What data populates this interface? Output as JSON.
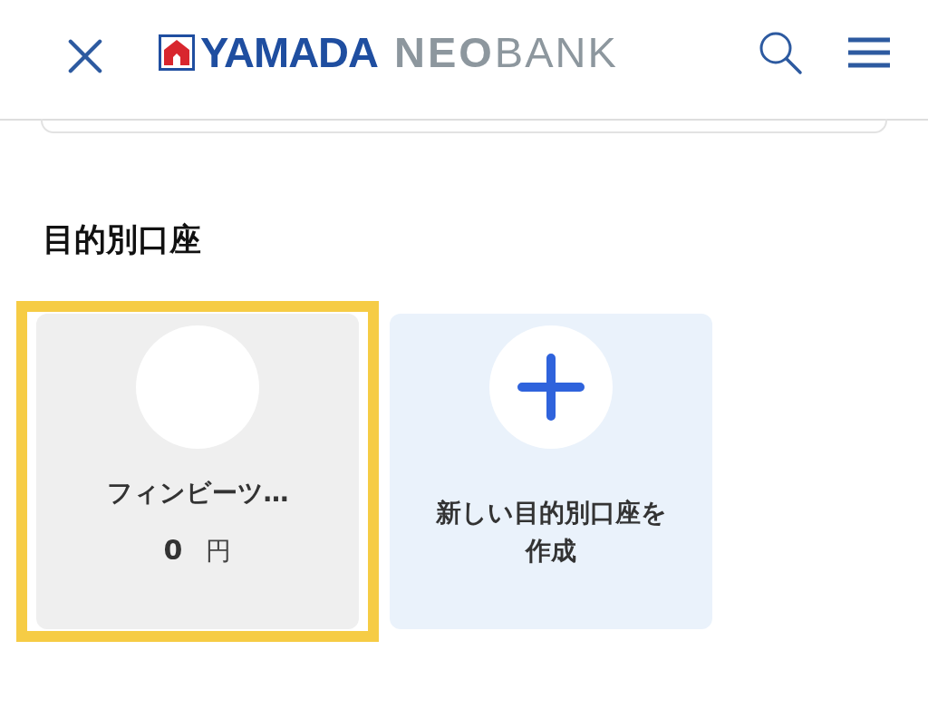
{
  "header": {
    "logo": {
      "brand": "YAMADA",
      "neo": "NEO",
      "bank": "BANK"
    }
  },
  "section": {
    "title": "目的別口座"
  },
  "accounts": [
    {
      "kind": "account",
      "name": "フィンビーツ…",
      "amount": "0",
      "unit": "円",
      "highlighted": true
    },
    {
      "kind": "create",
      "label": "新しい目的別口座を作成",
      "highlighted": false
    }
  ]
}
